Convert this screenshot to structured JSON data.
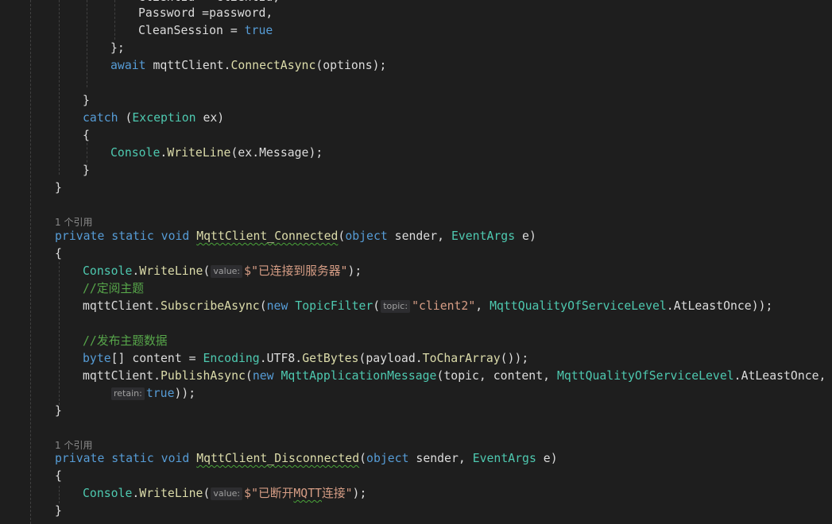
{
  "code": {
    "l1": "Password =password,",
    "l2_prop": "CleanSession",
    "l2_eq": " = ",
    "l2_val": "true",
    "l3": "};",
    "l4_await": "await",
    "l4_rest1": " mqttClient.",
    "l4_method": "ConnectAsync",
    "l4_rest2": "(options);",
    "l5": "}",
    "l6_catch": "catch",
    "l6_open": " (",
    "l6_type": "Exception",
    "l6_rest": " ex)",
    "l7": "{",
    "l8_cls": "Console",
    "l8_dot": ".",
    "l8_m": "WriteLine",
    "l8_rest": "(ex.Message);",
    "l9": "}",
    "l10": "}",
    "lens1": "1 个引用",
    "m1_private": "private",
    "m1_static": "static",
    "m1_void": "void",
    "m1_name": "MqttClient_Connected",
    "m1_object": "object",
    "m1_sender": " sender, ",
    "m1_eventargs": "EventArgs",
    "m1_e": " e)",
    "m1_open": "{",
    "m1_l1_cls": "Console",
    "m1_l1_m": "WriteLine",
    "m1_l1_hint": "value:",
    "m1_l1_str": "$\"已连接到服务器\"",
    "m1_l1_end": ");",
    "m1_cmt1": "//定阅主题",
    "m1_l3_a": "mqttClient.",
    "m1_l3_m": "SubscribeAsync",
    "m1_l3_new": "new",
    "m1_l3_type": "TopicFilter",
    "m1_l3_hint": "topic:",
    "m1_l3_str": "\"client2\"",
    "m1_l3_enum": "MqttQualityOfServiceLevel",
    "m1_l3_end": ".AtLeastOnce));",
    "m1_cmt2": "//发布主题数据",
    "m1_l5_byte": "byte",
    "m1_l5_a": "[] content = ",
    "m1_l5_enc": "Encoding",
    "m1_l5_b": ".UTF8.",
    "m1_l5_m1": "GetBytes",
    "m1_l5_c": "(payload.",
    "m1_l5_m2": "ToCharArray",
    "m1_l5_d": "());",
    "m1_l6_a": "mqttClient.",
    "m1_l6_m": "PublishAsync",
    "m1_l6_new": "new",
    "m1_l6_type": "MqttApplicationMessage",
    "m1_l6_b": "(topic, content, ",
    "m1_l6_enum": "MqttQualityOfServiceLevel",
    "m1_l6_c": ".AtLeastOnce,",
    "m1_l7_hint": "retain:",
    "m1_l7_val": "true",
    "m1_l7_end": "));",
    "m1_close": "}",
    "lens2": "1 个引用",
    "m2_private": "private",
    "m2_static": "static",
    "m2_void": "void",
    "m2_name": "MqttClient_Disconnected",
    "m2_object": "object",
    "m2_sender": " sender, ",
    "m2_eventargs": "EventArgs",
    "m2_e": " e)",
    "m2_open": "{",
    "m2_l1_cls": "Console",
    "m2_l1_m": "WriteLine",
    "m2_l1_hint": "value:",
    "m2_l1_str_a": "$\"已断开",
    "m2_l1_str_b": "MQTT",
    "m2_l1_str_c": "连接\"",
    "m2_l1_end": ");",
    "m2_close": "}"
  }
}
